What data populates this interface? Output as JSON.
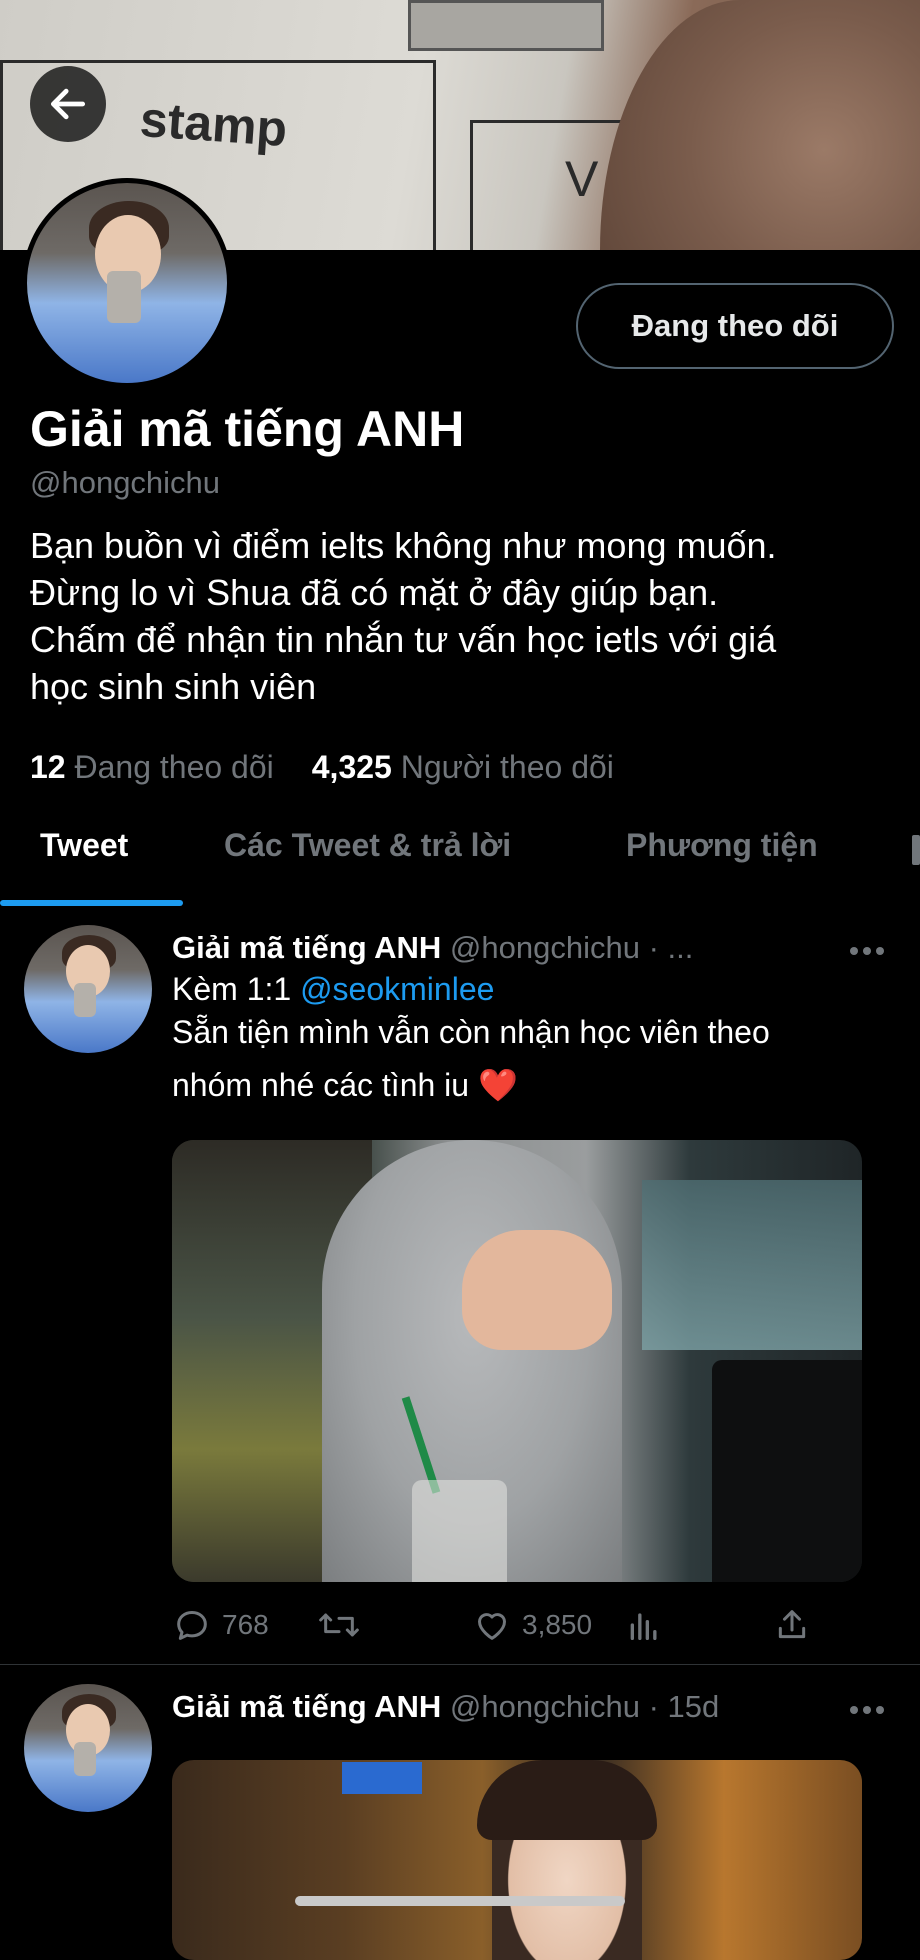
{
  "banner": {
    "text_stamp": "stamp",
    "text_v": "V"
  },
  "profile": {
    "follow_button_label": "Đang theo dõi",
    "display_name": "Giải mã tiếng ANH",
    "handle": "@hongchichu",
    "bio_lines": [
      "Bạn buồn vì điểm ielts không như mong muốn.",
      "Đừng lo vì Shua đã có mặt ở đây giúp bạn.",
      "Chấm để nhận tin nhắn tư vấn học ietls với giá",
      "học sinh sinh viên"
    ],
    "following_count": "12",
    "following_label": "Đang theo dõi",
    "followers_count": "4,325",
    "followers_label": "Người theo dõi"
  },
  "tabs": [
    {
      "label": "Tweet",
      "active": true
    },
    {
      "label": "Các Tweet & trả lời",
      "active": false
    },
    {
      "label": "Phương tiện",
      "active": false
    }
  ],
  "tweets": [
    {
      "name": "Giải mã tiếng ANH",
      "handle_time": "@hongchichu · ...",
      "line1_prefix": "Kèm 1:1",
      "line1_mention": "@seokminlee",
      "line2": "Sẵn tiện mình vẫn còn nhận học viên theo",
      "line3": "nhóm nhé các tình iu",
      "emoji": "❤️",
      "replies": "768",
      "retweets": "",
      "likes": "3,850"
    },
    {
      "name": "Giải mã tiếng ANH",
      "handle_time": "@hongchichu · 15d"
    }
  ],
  "colors": {
    "accent": "#1d9bf0",
    "background": "#000000",
    "secondary_text": "#71767b",
    "heart": "#f4212e"
  }
}
